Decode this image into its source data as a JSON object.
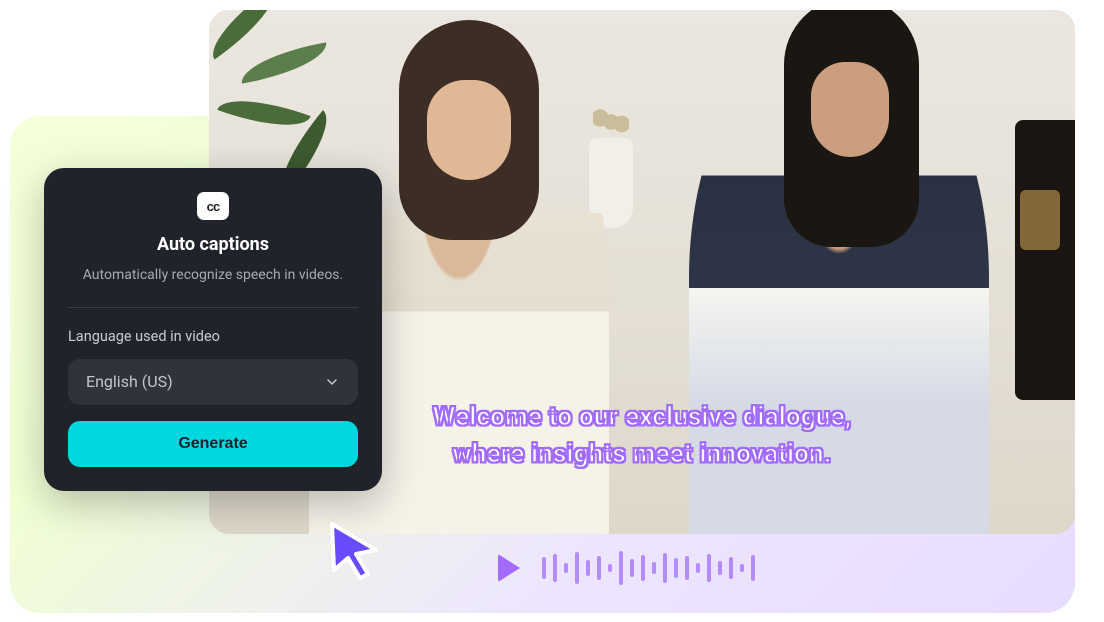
{
  "panel": {
    "title": "Auto captions",
    "description": "Automatically recognize speech in videos.",
    "language_label": "Language used in video",
    "language_selected": "English (US)",
    "generate_label": "Generate"
  },
  "caption": {
    "line1": "Welcome to our exclusive dialogue,",
    "line2": "where insights meet innovation."
  },
  "waveform_heights": [
    22,
    28,
    10,
    32,
    16,
    24,
    8,
    34,
    18,
    26,
    12,
    30,
    20,
    24,
    10,
    28,
    14,
    22,
    8,
    26
  ]
}
